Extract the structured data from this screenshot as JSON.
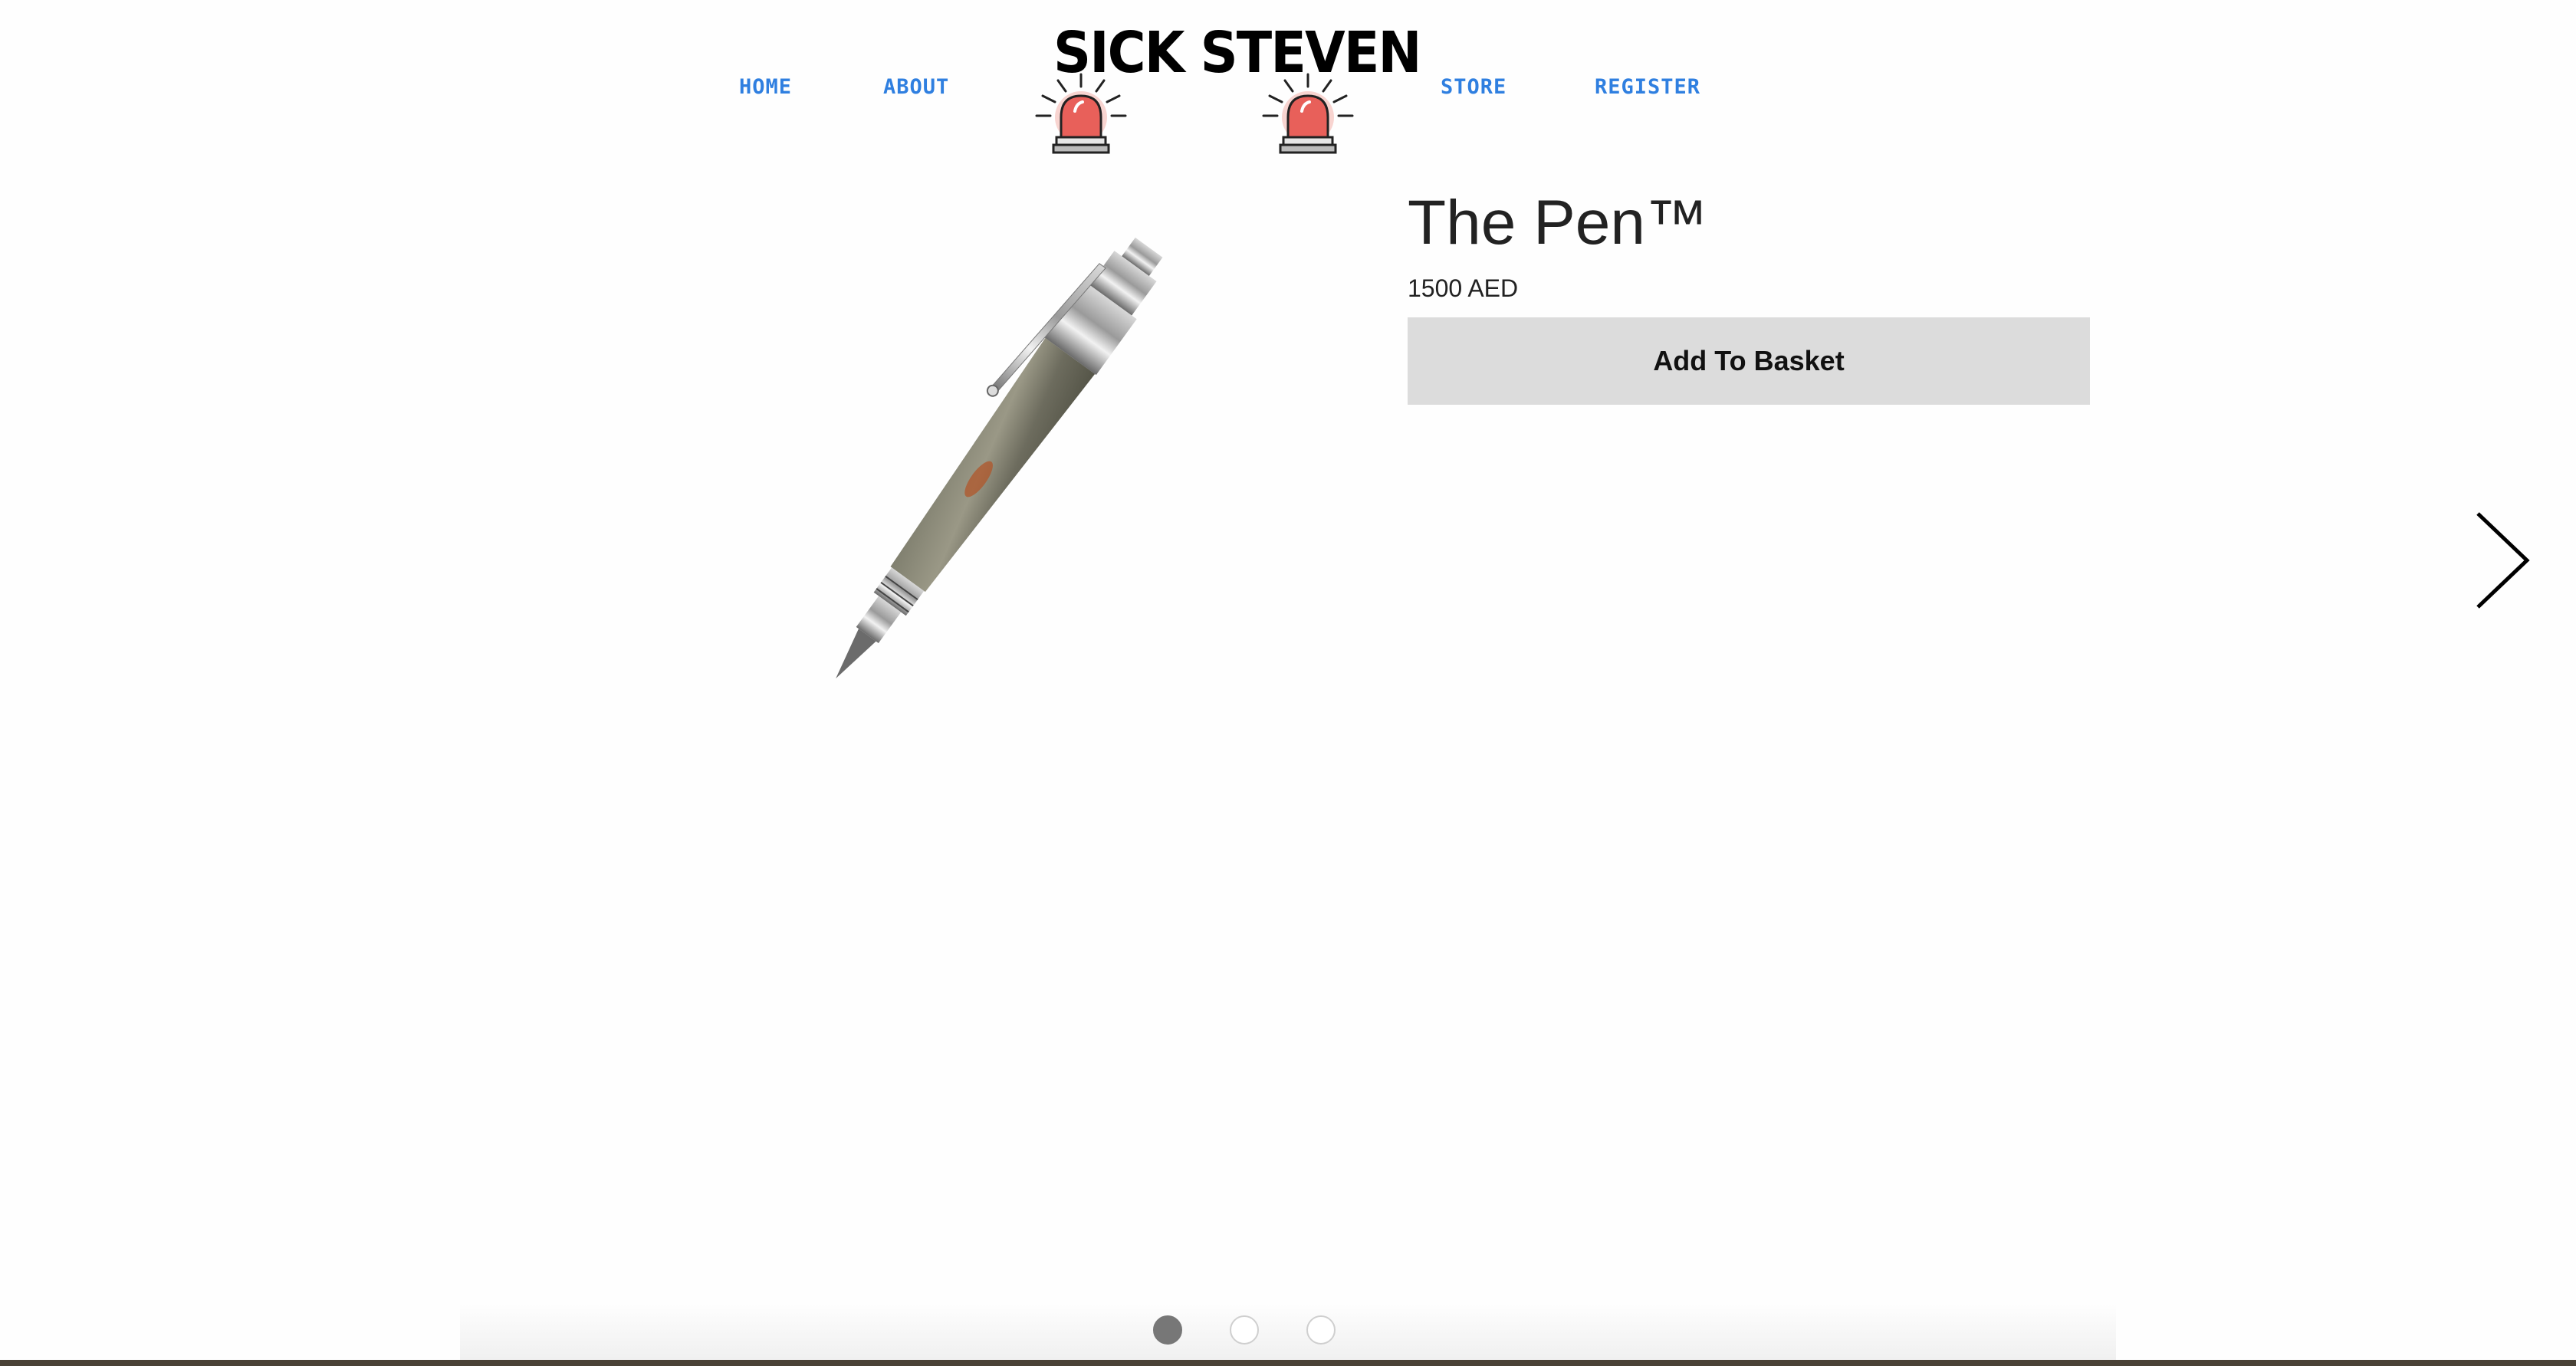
{
  "header": {
    "nav": [
      {
        "label": "HOME"
      },
      {
        "label": "ABOUT"
      },
      {
        "label": "STORE"
      },
      {
        "label": "REGISTER"
      }
    ],
    "logo": {
      "text": "SICK STEVEN",
      "icons": [
        "siren-icon",
        "siren-icon"
      ]
    }
  },
  "product": {
    "title": "The Pen™",
    "price": "1500 AED",
    "add_button_label": "Add To Basket",
    "image": "pen-image"
  },
  "carousel": {
    "next_icon": "chevron-right-icon",
    "dots_count": 3,
    "active_index": 0
  },
  "colors": {
    "nav_link": "#2f7fe0",
    "button_bg": "#dcdcdc",
    "dot_active": "#777777",
    "dot_inactive_border": "#cfcfcf",
    "siren_red": "#e8605a"
  }
}
